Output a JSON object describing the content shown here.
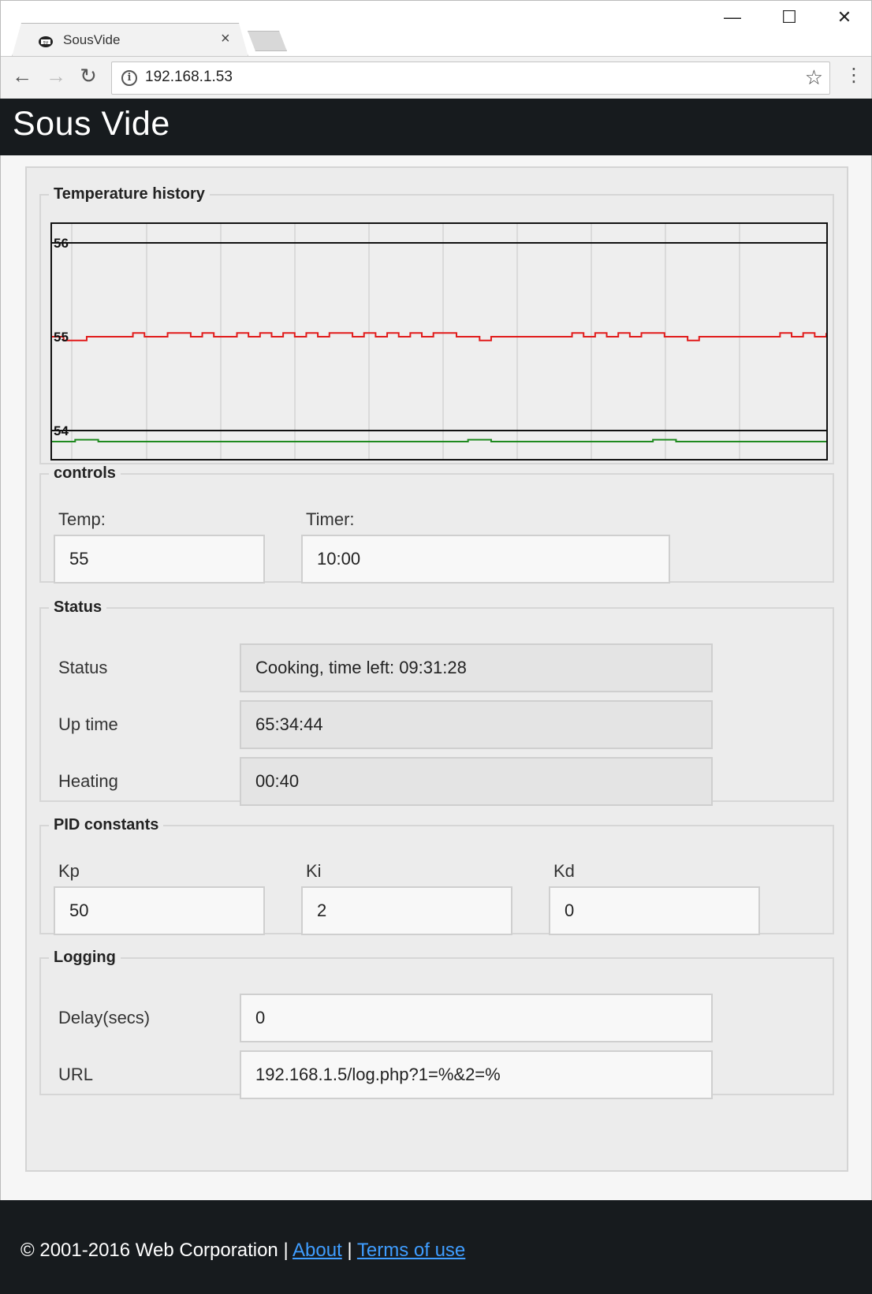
{
  "browser": {
    "tab_title": "SousVide",
    "tab_close": "×",
    "url": "192.168.1.53",
    "controls": {
      "minimize": "—",
      "maximize": "☐",
      "close": "✕"
    }
  },
  "page": {
    "title": "Sous Vide"
  },
  "temperature_history": {
    "legend": "Temperature history"
  },
  "chart_data": {
    "type": "line",
    "y_tick_labels": [
      "56",
      "55",
      "54"
    ],
    "ylim": [
      54,
      56
    ],
    "grid": true,
    "colors": {
      "setpoint": "#e11b1b",
      "heater": "#1e8a1e",
      "bounds": "#111111"
    },
    "series": [
      {
        "values": [
          55,
          54.96,
          54.96,
          55,
          55,
          55,
          55,
          55.04,
          55,
          55,
          55.04,
          55.04,
          55,
          55.04,
          55,
          55,
          55.04,
          55,
          55.04,
          55,
          55.04,
          55,
          55.04,
          55,
          55.04,
          55.04,
          55,
          55.04,
          55,
          55.04,
          55,
          55.04,
          55,
          55.04,
          55.04,
          55,
          55,
          54.96,
          55,
          55,
          55,
          55,
          55,
          55,
          55,
          55.04,
          55,
          55.04,
          55,
          55.04,
          55,
          55.04,
          55.04,
          55,
          55,
          54.96,
          55,
          55,
          55,
          55,
          55,
          55,
          55,
          55.04,
          55,
          55.04,
          55,
          55.04
        ]
      },
      {
        "values": [
          54,
          54,
          54.02,
          54.02,
          54,
          54,
          54,
          54,
          54,
          54,
          54,
          54,
          54,
          54,
          54,
          54,
          54,
          54,
          54,
          54,
          54,
          54,
          54,
          54,
          54,
          54,
          54,
          54,
          54,
          54,
          54,
          54,
          54,
          54,
          54,
          54,
          54.02,
          54.02,
          54,
          54,
          54,
          54,
          54,
          54,
          54,
          54,
          54,
          54,
          54,
          54,
          54,
          54,
          54.02,
          54.02,
          54,
          54,
          54,
          54,
          54,
          54,
          54,
          54,
          54,
          54,
          54,
          54,
          54,
          54
        ]
      }
    ]
  },
  "controls": {
    "legend": "controls",
    "temp_label": "Temp:",
    "temp_value": "55",
    "timer_label": "Timer:",
    "timer_value": "10:00"
  },
  "status": {
    "legend": "Status",
    "rows": [
      {
        "label": "Status",
        "value": "Cooking, time left:  09:31:28"
      },
      {
        "label": "Up time",
        "value": "65:34:44"
      },
      {
        "label": "Heating",
        "value": "00:40"
      }
    ]
  },
  "pid": {
    "legend": "PID constants",
    "kp_label": "Kp",
    "kp_value": "50",
    "ki_label": "Ki",
    "ki_value": "2",
    "kd_label": "Kd",
    "kd_value": "0"
  },
  "logging": {
    "legend": "Logging",
    "delay_label": "Delay(secs)",
    "delay_value": "0",
    "url_label": "URL",
    "url_value": "192.168.1.5/log.php?1=%&2=%"
  },
  "footer": {
    "copyright": "© 2001-2016 Web Corporation | ",
    "about": "About",
    "separator": " | ",
    "terms": "Terms of use"
  }
}
